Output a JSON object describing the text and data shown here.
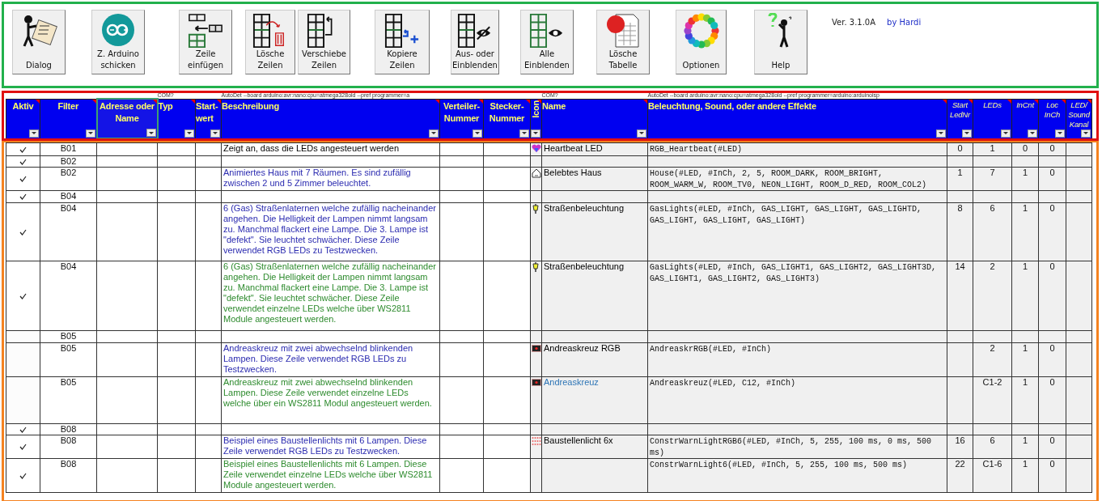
{
  "toolbar": {
    "buttons": [
      {
        "kind": "dialog",
        "label": "Dialog"
      },
      {
        "kind": "arduino",
        "label": "Z. Arduino\nschicken"
      },
      {
        "kind": "insert",
        "label": "Zeile\neinfügen"
      },
      {
        "kind": "delete",
        "label": "Lösche\nZeilen"
      },
      {
        "kind": "move",
        "label": "Verschiebe\nZeilen"
      },
      {
        "kind": "copy",
        "label": "Kopiere\nZeilen"
      },
      {
        "kind": "hide",
        "label": "Aus- oder\nEinblenden"
      },
      {
        "kind": "show",
        "label": "Alle\nEinblenden"
      },
      {
        "kind": "clear",
        "label": "Lösche\nTabelle"
      },
      {
        "kind": "options",
        "label": "Optionen"
      },
      {
        "kind": "help",
        "label": "Help"
      }
    ],
    "version": "Ver. 3.1.0A",
    "author": "by  Hardi"
  },
  "config_line": {
    "typ": "COM?",
    "beschreibung": "AutoDet --board arduino:avr:nano:cpu=atmega328old --pref programmer=a",
    "name": "COM?",
    "effekte": "AutoDet --board arduino:avr:nano:cpu=atmega328old --pref programmer=arduino:arduinoisp"
  },
  "columns": [
    {
      "label": "Aktiv",
      "kind": "main",
      "selected": false
    },
    {
      "label": "Filter",
      "kind": "main",
      "selected": false
    },
    {
      "label": "Adresse oder Name",
      "kind": "main",
      "selected": true
    },
    {
      "label": "Typ",
      "kind": "main",
      "selected": false
    },
    {
      "label": "Start-wert",
      "kind": "main",
      "selected": false
    },
    {
      "label": "Beschreibung",
      "kind": "main",
      "selected": false
    },
    {
      "label": "Verteiler-Nummer",
      "kind": "main",
      "selected": false
    },
    {
      "label": "Stecker-Nummer",
      "kind": "main",
      "selected": false
    },
    {
      "label": "Icon",
      "kind": "vertical",
      "selected": false
    },
    {
      "label": "Name",
      "kind": "main",
      "selected": false
    },
    {
      "label": "Beleuchtung, Sound, oder andere Effekte",
      "kind": "main",
      "selected": false
    },
    {
      "label": "Start LedNr",
      "kind": "small",
      "selected": false
    },
    {
      "label": "LEDs",
      "kind": "small",
      "selected": false
    },
    {
      "label": "InCnt",
      "kind": "small",
      "selected": false
    },
    {
      "label": "Loc InCh",
      "kind": "small",
      "selected": false
    },
    {
      "label": "LED/ Sound Kanal",
      "kind": "small",
      "selected": false
    }
  ],
  "rows": [
    {
      "active": true,
      "filter": "B01",
      "description": {
        "text": "Zeigt an, dass die LEDs angesteuert werden",
        "color": "#000000"
      },
      "kind": "heart",
      "name": {
        "text": "Heartbeat LED",
        "color": "#000000"
      },
      "effect": "RGB_Heartbeat(#LED)",
      "start_led": "0",
      "leds": "1",
      "in_cnt": "0",
      "loc_in_ch": "0"
    },
    {
      "active": true,
      "filter": "B02"
    },
    {
      "active": true,
      "filter": "B02",
      "description": {
        "text": "Animiertes Haus mit 7 Räumen. Es sind zufällig zwischen 2 und 5 Zimmer beleuchtet.",
        "color": "#2b2bb0"
      },
      "kind": "house",
      "name": {
        "text": "Belebtes Haus",
        "color": "#000000"
      },
      "effect": "House(#LED, #InCh, 2, 5, ROOM_DARK, ROOM_BRIGHT, ROOM_WARM_W, ROOM_TV0, NEON_LIGHT, ROOM_D_RED, ROOM_COL2)",
      "start_led": "1",
      "leds": "7",
      "in_cnt": "1",
      "loc_in_ch": "0"
    },
    {
      "active": true,
      "filter": "B04"
    },
    {
      "active": true,
      "filter": "B04",
      "description": {
        "text": "6 (Gas) Straßenlaternen welche zufällig nacheinander angehen. Die Helligkeit der Lampen nimmt langsam zu. Manchmal flackert eine Lampe. Die 3. Lampe ist \"defekt\". Sie leuchtet schwächer. Diese Zeile verwendet RGB LEDs zu Testzwecken.",
        "color": "#2b2bb0"
      },
      "kind": "lantern",
      "name": {
        "text": "Straßenbeleuchtung",
        "color": "#000000"
      },
      "effect": "GasLights(#LED, #InCh, GAS_LIGHT, GAS_LIGHT, GAS_LIGHTD, GAS_LIGHT, GAS_LIGHT, GAS_LIGHT)",
      "start_led": "8",
      "leds": "6",
      "in_cnt": "1",
      "loc_in_ch": "0"
    },
    {
      "active": true,
      "filter": "B04",
      "description": {
        "text": "6 (Gas) Straßenlaternen welche zufällig nacheinander angehen. Die Helligkeit der Lampen nimmt langsam zu. Manchmal flackert eine Lampe. Die 3. Lampe ist \"defekt\". Sie leuchtet schwächer. Diese Zeile verwendet einzelne LEDs welche über WS2811 Module angesteuert werden.",
        "color": "#2e8b2e"
      },
      "kind": "lantern",
      "name": {
        "text": "Straßenbeleuchtung",
        "color": "#000000"
      },
      "effect": "GasLights(#LED, #InCh, GAS_LIGHT1, GAS_LIGHT2, GAS_LIGHT3D, GAS_LIGHT1, GAS_LIGHT2, GAS_LIGHT3)",
      "start_led": "14",
      "leds": "2",
      "in_cnt": "1",
      "loc_in_ch": "0"
    },
    {
      "active": false,
      "filter": "B05"
    },
    {
      "active": false,
      "filter": "B05",
      "description": {
        "text": "Andreaskreuz mit zwei abwechselnd blinkenden Lampen. Diese Zeile verwendet RGB LEDs zu Testzwecken.",
        "color": "#2b2bb0"
      },
      "kind": "crossing",
      "name": {
        "text": "Andreaskreuz RGB",
        "color": "#000000"
      },
      "effect": "AndreaskrRGB(#LED, #InCh)",
      "leds": "2",
      "in_cnt": "1",
      "loc_in_ch": "0"
    },
    {
      "active": false,
      "filter": "B05",
      "description": {
        "text": "Andreaskreuz mit zwei abwechselnd blinkenden Lampen. Diese Zeile verwendet einzelne LEDs welche über ein WS2811 Modul angesteuert werden.",
        "color": "#2e8b2e"
      },
      "kind": "crossing",
      "name": {
        "text": "Andreaskreuz",
        "color": "#2e75b6"
      },
      "effect": "Andreaskreuz(#LED, C12, #InCh)",
      "leds": "C1-2",
      "in_cnt": "1",
      "loc_in_ch": "0"
    },
    {
      "active": true,
      "filter": "B08"
    },
    {
      "active": true,
      "filter": "B08",
      "description": {
        "text": "Beispiel eines Baustellenlichts mit 6 Lampen. Diese Zeile verwendet RGB LEDs zu Testzwecken.",
        "color": "#2b2bb0"
      },
      "kind": "dots",
      "name": {
        "text": "Baustellenlicht 6x",
        "color": "#000000"
      },
      "effect": "ConstrWarnLightRGB6(#LED, #InCh, 5, 255, 100 ms, 0 ms, 500 ms)",
      "start_led": "16",
      "leds": "6",
      "in_cnt": "1",
      "loc_in_ch": "0"
    },
    {
      "active": true,
      "filter": "B08",
      "description": {
        "text": "Beispiel eines Baustellenlichts mit 6 Lampen. Diese Zeile verwendet einzelne LEDs welche über WS2811 Module angesteuert werden.",
        "color": "#2e8b2e"
      },
      "effect": "ConstrWarnLight6(#LED, #InCh, 5, 255, 100 ms, 500 ms)",
      "start_led": "22",
      "leds": "C1-6",
      "in_cnt": "1",
      "loc_in_ch": "0"
    }
  ]
}
